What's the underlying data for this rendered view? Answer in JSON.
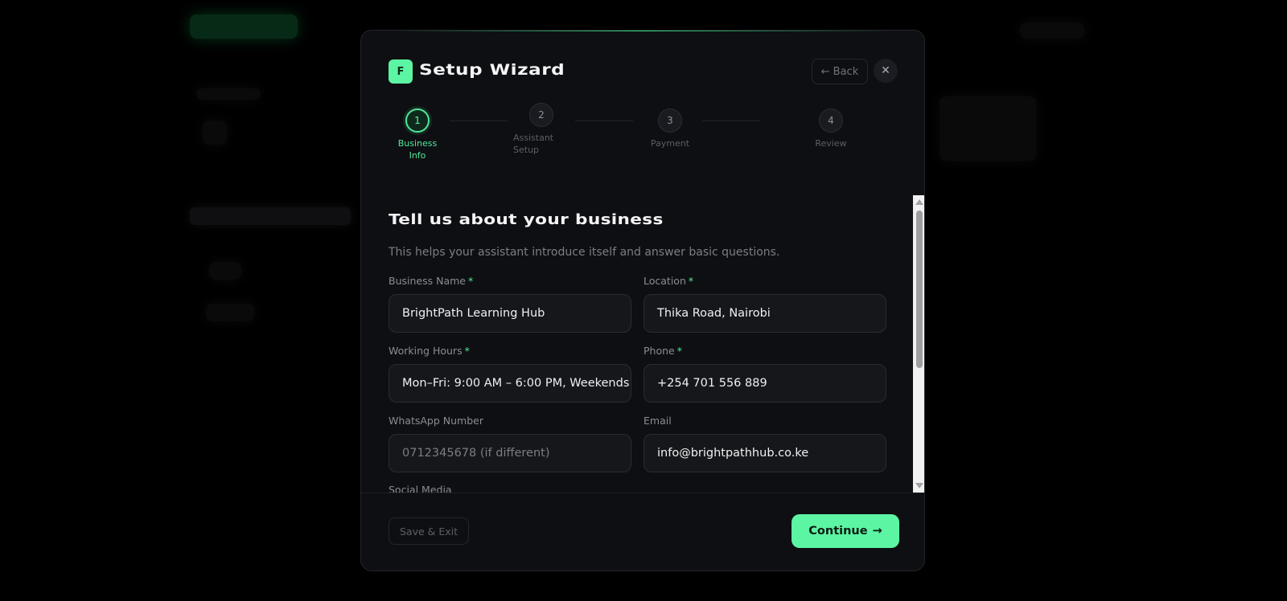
{
  "wizard": {
    "logo_letter": "F",
    "title": "Setup Wizard",
    "back_label": "Back",
    "back_arrow": "←",
    "close_glyph": "✕"
  },
  "steps": [
    {
      "number": "1",
      "label": "Business Info",
      "active": true
    },
    {
      "number": "2",
      "label": "Assistant Setup",
      "active": false
    },
    {
      "number": "3",
      "label": "Payment",
      "active": false
    },
    {
      "number": "4",
      "label": "Review",
      "active": false
    }
  ],
  "form": {
    "heading": "Tell us about your business",
    "subtext": "This helps your assistant introduce itself and answer basic questions.",
    "fields": {
      "business_name": {
        "label": "Business Name",
        "required_mark": "*",
        "value": "BrightPath Learning Hub"
      },
      "location": {
        "label": "Location",
        "required_mark": "*",
        "value": "Thika Road, Nairobi"
      },
      "working_hours": {
        "label": "Working Hours",
        "required_mark": "*",
        "value": "Mon–Fri: 9:00 AM – 6:00 PM, Weekends"
      },
      "phone": {
        "label": "Phone",
        "required_mark": "*",
        "value": "+254 701 556 889"
      },
      "whatsapp": {
        "label": "WhatsApp Number",
        "value": "",
        "placeholder": "0712345678 (if different)"
      },
      "email": {
        "label": "Email",
        "value": "info@brightpathhub.co.ke"
      },
      "social_media": {
        "label": "Social Media"
      }
    }
  },
  "footer": {
    "save_exit_label": "Save & Exit",
    "continue_label": "Continue",
    "continue_arrow": "→"
  },
  "colors": {
    "accent": "#5cf5a3",
    "background": "#000000",
    "modal": "#0e0f12"
  }
}
